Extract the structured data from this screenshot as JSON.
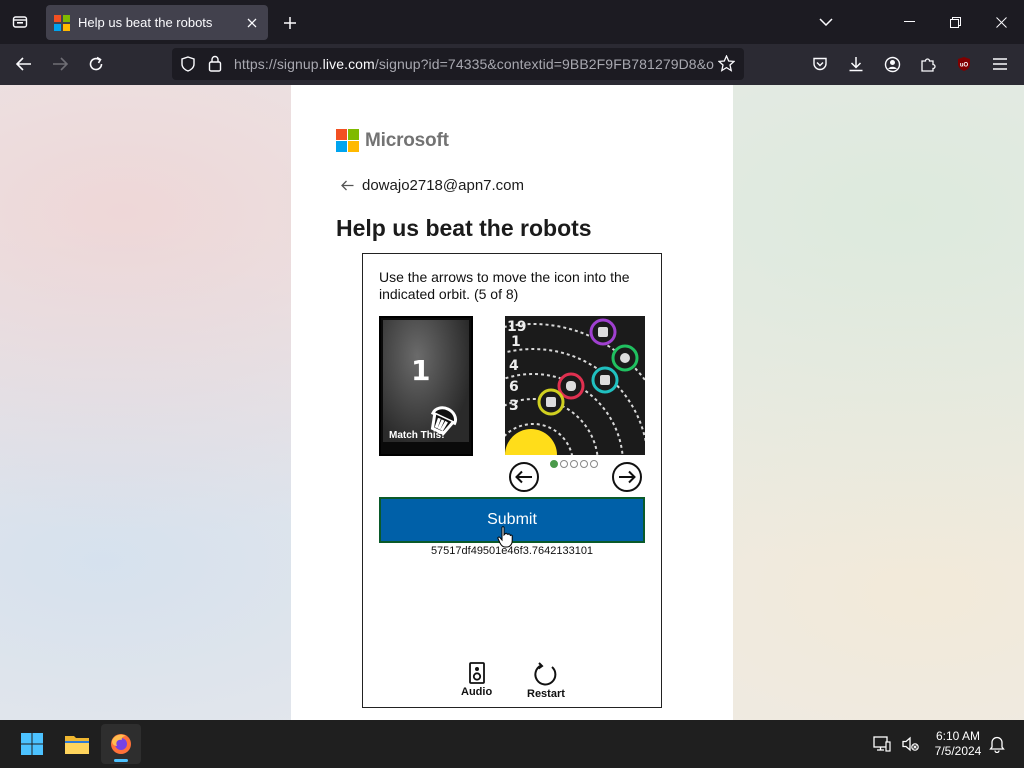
{
  "browser": {
    "tab_title": "Help us beat the robots",
    "url_prefix": "https://signup.",
    "url_domain": "live.com",
    "url_suffix": "/signup?id=74335&contextid=9BB2F9FB781279D8&o"
  },
  "page": {
    "brand": "Microsoft",
    "email": "dowajo2718@apn7.com",
    "heading": "Help us beat the robots"
  },
  "captcha": {
    "instructions": "Use the arrows to move the icon into the indicated orbit. (5 of 8)",
    "match_number": "1",
    "match_label": "Match This!",
    "orbit_labels": [
      "19",
      "1",
      "4",
      "6",
      "3"
    ],
    "pager": {
      "total": 5,
      "active": 1
    },
    "submit_label": "Submit",
    "session_id": "57517df49501e46f3.7642133101",
    "audio_label": "Audio",
    "restart_label": "Restart"
  },
  "taskbar": {
    "time": "6:10 AM",
    "date": "7/5/2024"
  },
  "colors": {
    "submit": "#0060a8",
    "pager_active": "#4a9a4a",
    "tab_active": "#42414d",
    "taskbar_accent": "#4cc2ff"
  }
}
